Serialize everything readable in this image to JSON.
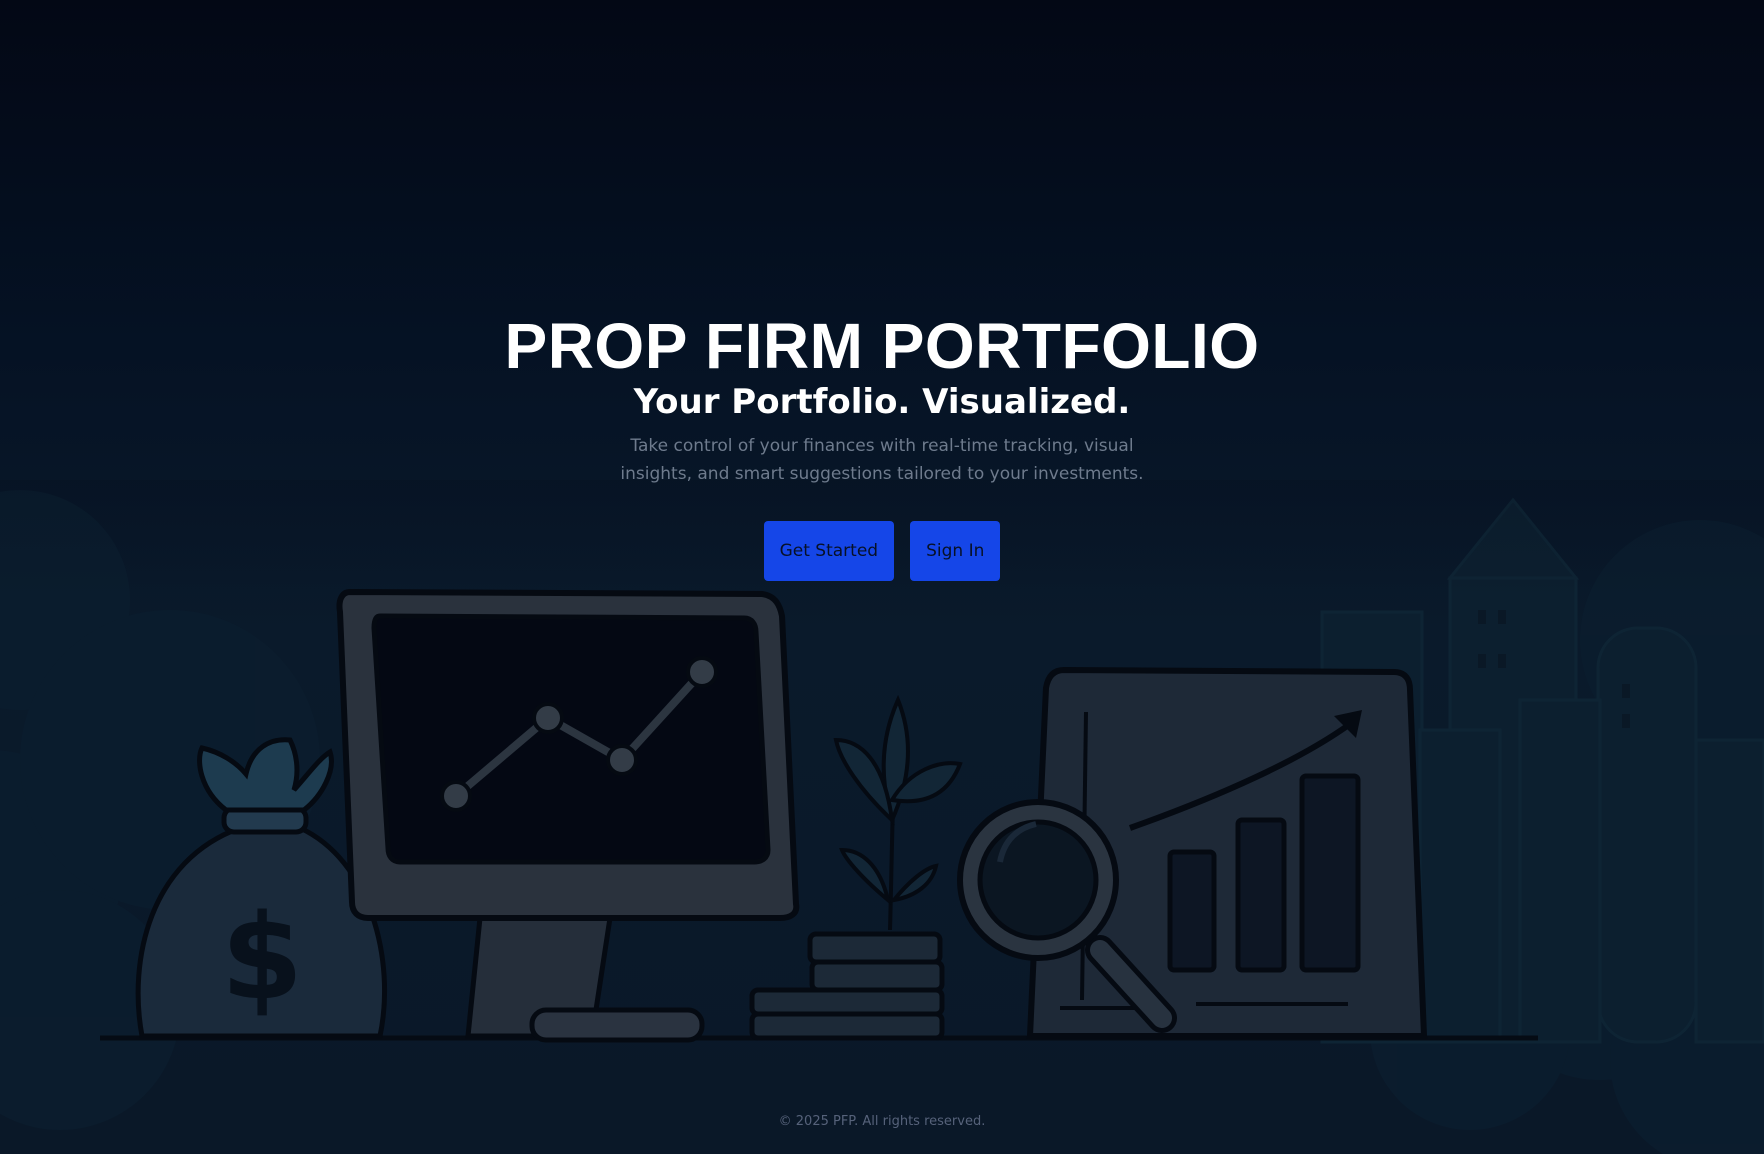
{
  "hero": {
    "title": "PROP FIRM PORTFOLIO",
    "tagline": "Your Portfolio. Visualized.",
    "description": "Take control of your finances with real-time tracking, visual insights, and smart suggestions tailored to your investments."
  },
  "actions": {
    "get_started_label": "Get Started",
    "sign_in_label": "Sign In"
  },
  "footer": {
    "copyright": "© 2025 PFP. All rights reserved."
  },
  "illustration": {
    "icons": [
      "money-bag-icon",
      "monitor-chart-icon",
      "plant-icon",
      "coin-stack-icon",
      "magnifying-glass-icon",
      "bar-chart-board-icon",
      "city-buildings-icon"
    ],
    "money_bag_symbol": "$"
  },
  "colors": {
    "background_top": "#030815",
    "background_bottom": "#0a1828",
    "button": "#1546e8",
    "title": "#ffffff",
    "description": "#6e7b8d"
  }
}
